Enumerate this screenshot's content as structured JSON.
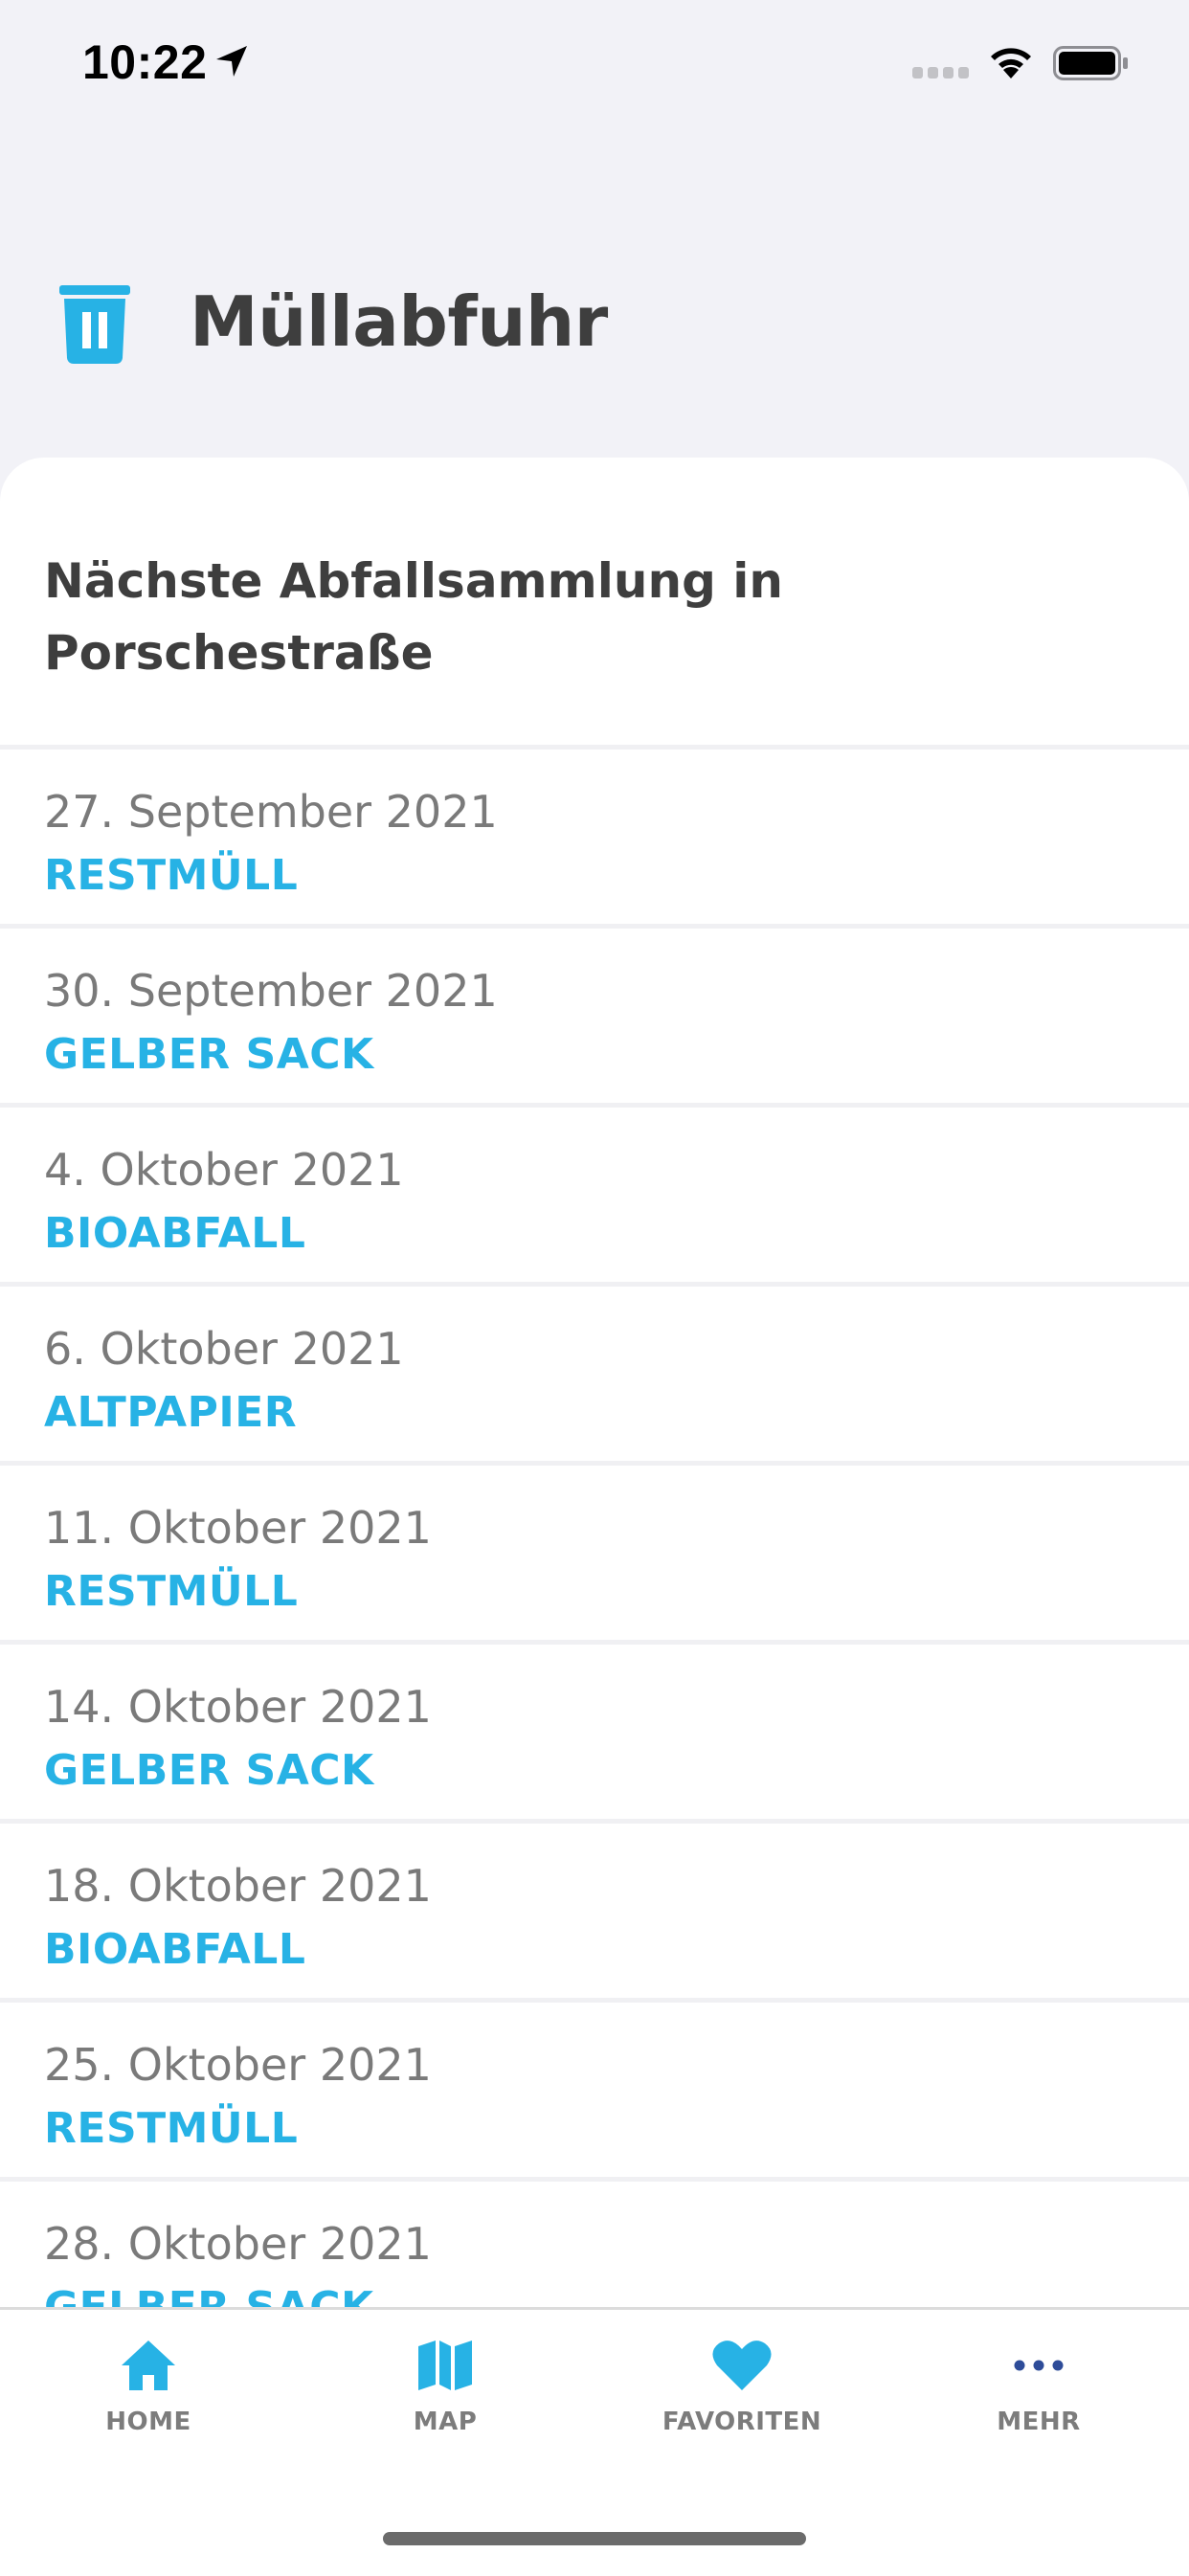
{
  "status_bar": {
    "time": "10:22"
  },
  "header": {
    "title": "Müllabfuhr"
  },
  "section": {
    "title": "Nächste Abfallsammlung in Porschestraße"
  },
  "collections": [
    {
      "date": "27. September 2021",
      "type": "RESTMÜLL"
    },
    {
      "date": "30. September 2021",
      "type": "GELBER SACK"
    },
    {
      "date": "4. Oktober 2021",
      "type": "BIOABFALL"
    },
    {
      "date": "6. Oktober 2021",
      "type": "ALTPAPIER"
    },
    {
      "date": "11. Oktober 2021",
      "type": "RESTMÜLL"
    },
    {
      "date": "14. Oktober 2021",
      "type": "GELBER SACK"
    },
    {
      "date": "18. Oktober 2021",
      "type": "BIOABFALL"
    },
    {
      "date": "25. Oktober 2021",
      "type": "RESTMÜLL"
    },
    {
      "date": "28. Oktober 2021",
      "type": "GELBER SACK"
    }
  ],
  "tabs": [
    {
      "label": "HOME",
      "icon": "home-icon"
    },
    {
      "label": "MAP",
      "icon": "map-icon"
    },
    {
      "label": "FAVORITEN",
      "icon": "heart-icon"
    },
    {
      "label": "MEHR",
      "icon": "more-icon"
    }
  ],
  "colors": {
    "accent": "#27b2e5",
    "more_icon": "#2e4c99",
    "text_dark": "#3e3e3e",
    "text_muted": "#7a7a7a"
  }
}
